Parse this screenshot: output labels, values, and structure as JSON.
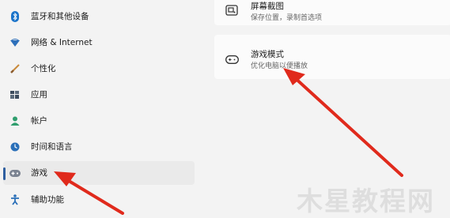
{
  "sidebar": {
    "items": [
      {
        "label": "蓝牙和其他设备",
        "icon": "bluetooth-icon"
      },
      {
        "label": "网络 & Internet",
        "icon": "network-icon"
      },
      {
        "label": "个性化",
        "icon": "brush-icon"
      },
      {
        "label": "应用",
        "icon": "apps-icon"
      },
      {
        "label": "帐户",
        "icon": "account-icon"
      },
      {
        "label": "时间和语言",
        "icon": "globe-clock-icon"
      },
      {
        "label": "游戏",
        "icon": "gamepad-icon",
        "selected": true
      },
      {
        "label": "辅助功能",
        "icon": "accessibility-icon"
      }
    ]
  },
  "main": {
    "cards": [
      {
        "title": "屏幕截图",
        "subtitle": "保存位置，录制首选项",
        "icon": "capture-icon"
      },
      {
        "title": "游戏模式",
        "subtitle": "优化电脑以便播放",
        "icon": "gamepad-icon"
      }
    ]
  },
  "watermark": "木星教程网",
  "colors": {
    "accent": "#2f5fa0",
    "arrow": "#e02a1c"
  }
}
